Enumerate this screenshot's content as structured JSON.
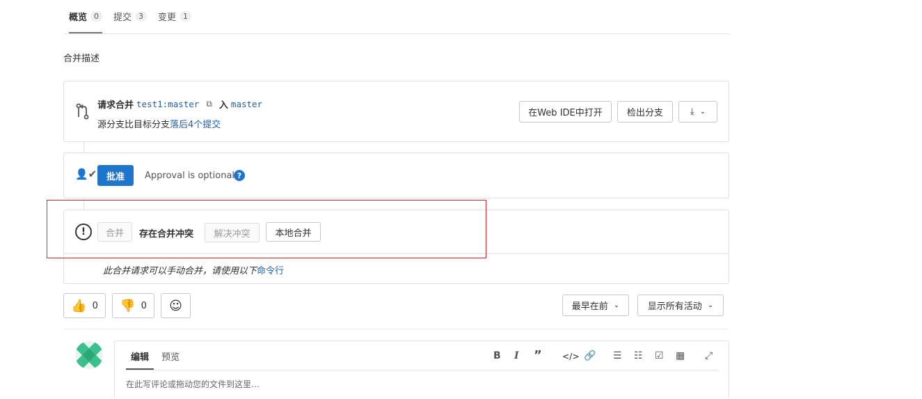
{
  "tabs": [
    {
      "label": "概览",
      "count": "0"
    },
    {
      "label": "提交",
      "count": "3"
    },
    {
      "label": "变更",
      "count": "1"
    }
  ],
  "description_title": "合并描述",
  "merge_request": {
    "prefix": "请求合并",
    "source_branch": "test1:master",
    "into": "入",
    "target_branch": "master",
    "behind_prefix": "源分支比目标分支",
    "behind_link": "落后4个提交",
    "web_ide_label": "在Web IDE中打开",
    "checkout_label": "检出分支"
  },
  "approval": {
    "approve_label": "批准",
    "optional_text": "Approval is optional"
  },
  "conflict": {
    "merge_label": "合并",
    "status_text": "存在合并冲突",
    "resolve_label": "解决冲突",
    "local_merge_label": "本地合并",
    "hint_text": "此合并请求可以手动合并，请使用以下",
    "hint_link": "命令行"
  },
  "reactions": {
    "thumbs_up_count": "0",
    "thumbs_down_count": "0"
  },
  "sort_label": "最早在前",
  "filter_label": "显示所有活动",
  "comment": {
    "tab_edit": "编辑",
    "tab_preview": "预览",
    "placeholder": "在此写评论或拖动您的文件到这里…"
  },
  "colors": {
    "accent": "#1f75cb",
    "link": "#1f5fa6",
    "highlight_box": "#dd2222"
  }
}
